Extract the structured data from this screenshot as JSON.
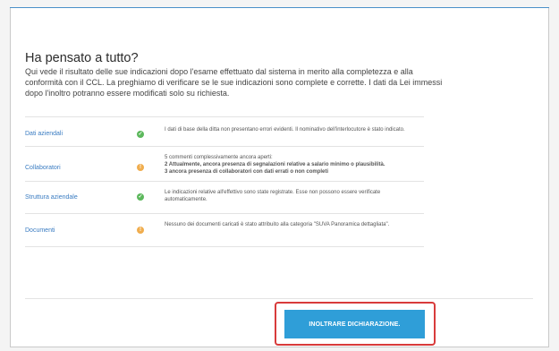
{
  "page": {
    "title": "Ha pensato a tutto?",
    "intro": "Qui vede il risultato delle sue indicazioni dopo l'esame effettuato dal sistema in merito alla completezza e alla conformità con il CCL. La preghiamo di verificare se le sue indicazioni sono complete e corrette. I dati da Lei immessi dopo l'inoltro potranno essere modificati solo su richiesta."
  },
  "rows": [
    {
      "label": "Dati aziendali",
      "status": "ok",
      "status_icon": "check-icon",
      "lines": [
        "I dati di base della ditta non presentano errori evidenti. Il nominativo dell'interlocutore è stato indicato."
      ]
    },
    {
      "label": "Collaboratori",
      "status": "warn",
      "status_icon": "exclamation-icon",
      "lines": [
        "5 commenti complessivamente ancora aperti:",
        "2 Attualmente, ancora presenza di segnalazioni relative a salario minimo o plausibilità.",
        "3 ancora presenza di collaboratori con dati errati o non completi"
      ]
    },
    {
      "label": "Struttura aziendale",
      "status": "ok",
      "status_icon": "check-icon",
      "lines": [
        "Le indicazioni relative all'effettivo sono state registrate. Esse non possono essere verificate automaticamente."
      ]
    },
    {
      "label": "Documenti",
      "status": "warn",
      "status_icon": "exclamation-icon",
      "lines": [
        "Nessuno dei documenti caricati è stato attribuito alla categoria \"SUVA Panoramica dettagliata\"."
      ]
    }
  ],
  "actions": {
    "submit_label": "INOLTRARE DICHIARAZIONE."
  },
  "colors": {
    "accent": "#2f9ed8",
    "link": "#3a7cc2",
    "ok": "#5cb85c",
    "warn": "#f0ad4e",
    "highlight": "#d83b3b"
  }
}
